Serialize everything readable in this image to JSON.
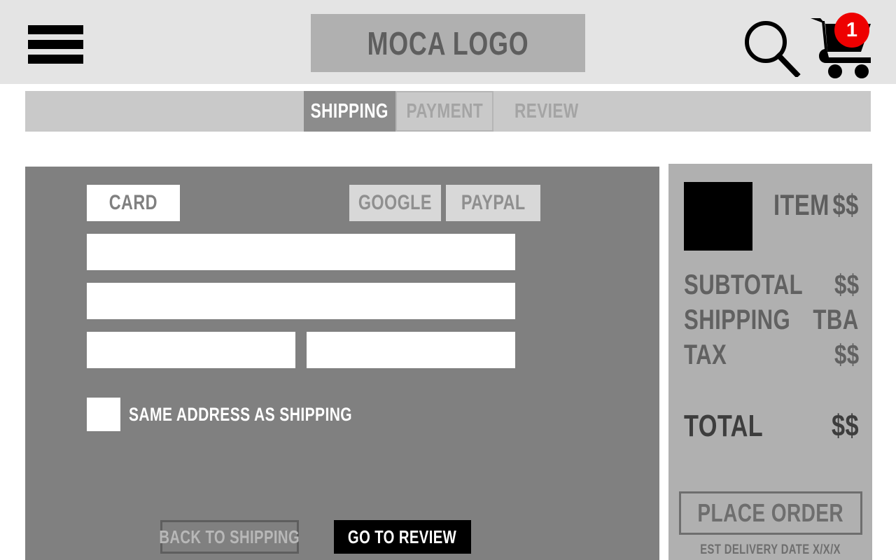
{
  "header": {
    "menu_icon": "hamburger-menu-icon",
    "logo_text": "MOCA LOGO",
    "search_icon": "search-icon",
    "cart_icon": "shopping-cart-icon",
    "cart_badge_count": "1",
    "background_color": "#e4e4e4",
    "logo_box_color": "#b0b0b0",
    "badge_color": "#ee0000"
  },
  "checkout_steps": {
    "tabs": [
      {
        "label": "SHIPPING",
        "state": "active"
      },
      {
        "label": "PAYMENT",
        "state": "outlined"
      },
      {
        "label": "REVIEW",
        "state": "plain"
      }
    ],
    "bar_color": "#c9c9c9",
    "active_color": "#8c8c8c"
  },
  "payment_form": {
    "panel_color": "#808080",
    "methods": [
      {
        "label": "CARD",
        "state": "selected"
      },
      {
        "label": "GOOGLE",
        "state": "unselected"
      },
      {
        "label": "PAYPAL",
        "state": "unselected"
      }
    ],
    "fields": [
      {
        "name": "card-number",
        "value": "",
        "placeholder": ""
      },
      {
        "name": "name-on-card",
        "value": "",
        "placeholder": ""
      },
      {
        "name": "expiry-date",
        "value": "",
        "placeholder": ""
      },
      {
        "name": "security-code",
        "value": "",
        "placeholder": ""
      }
    ],
    "same_address_label": "SAME ADDRESS AS SHIPPING",
    "same_address_checked": false,
    "back_button": "BACK TO SHIPPING",
    "next_button": "GO TO REVIEW"
  },
  "order_summary": {
    "panel_color": "#b0b0b0",
    "item": {
      "thumbnail": "product-thumbnail",
      "name": "ITEM",
      "price": "$$"
    },
    "lines": [
      {
        "label": "SUBTOTAL",
        "value": "$$"
      },
      {
        "label": "SHIPPING",
        "value": "TBA"
      },
      {
        "label": "TAX",
        "value": "$$"
      }
    ],
    "total": {
      "label": "TOTAL",
      "value": "$$"
    },
    "place_order_button": "PLACE ORDER",
    "delivery_note": "EST DELIVERY DATE X/X/X"
  }
}
